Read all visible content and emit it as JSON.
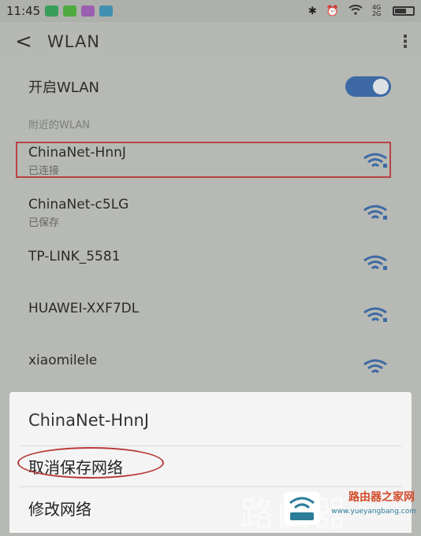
{
  "status_bar": {
    "time": "11:45",
    "signal_text": "4G 2G",
    "app_icons": [
      "message-icon",
      "wechat-icon",
      "browser-icon",
      "screenshot-icon"
    ],
    "right_icons": [
      "bluetooth-icon",
      "alarm-icon",
      "wifi-icon",
      "signal-icon",
      "battery-icon"
    ]
  },
  "header": {
    "back_glyph": "<",
    "title": "WLAN",
    "more_glyph": "⋮"
  },
  "wlan_toggle": {
    "label": "开启WLAN",
    "enabled": true,
    "accent_color": "#3d6aa4"
  },
  "section": {
    "title": "附近的WLAN"
  },
  "networks": [
    {
      "name": "ChinaNet-HnnJ",
      "status": "已连接"
    },
    {
      "name": "ChinaNet-c5LG",
      "status": "已保存"
    },
    {
      "name": "TP-LINK_5581",
      "status": ""
    },
    {
      "name": "HUAWEI-XXF7DL",
      "status": ""
    },
    {
      "name": "xiaomilele",
      "status": ""
    }
  ],
  "dialog": {
    "title": "ChinaNet-HnnJ",
    "items": [
      "取消保存网络",
      "修改网络"
    ]
  },
  "watermark": {
    "big_text": "路由器",
    "site_name": "路由器之家网",
    "site_url": "www.yueyangbang.com"
  }
}
